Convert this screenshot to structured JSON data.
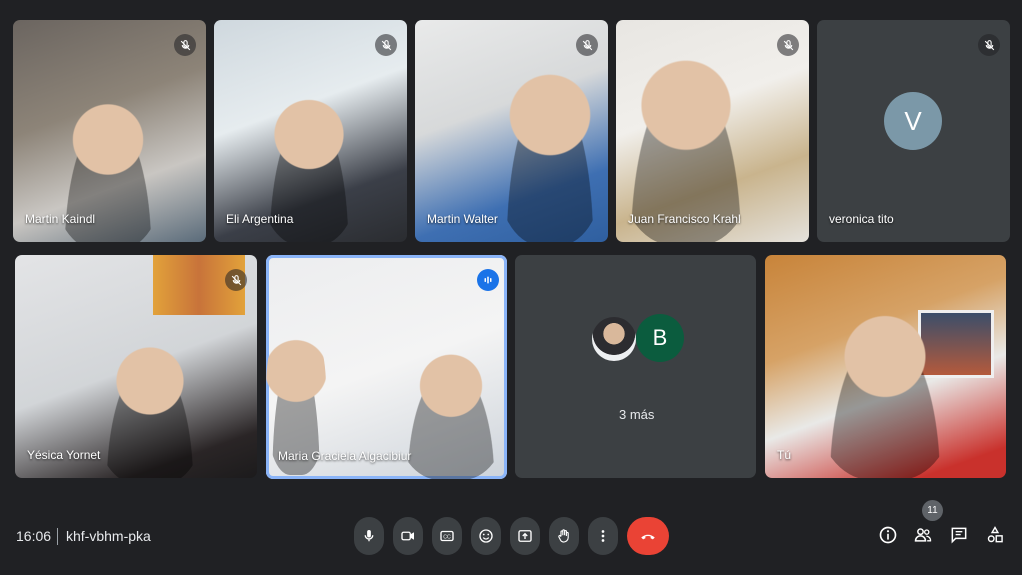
{
  "participants": [
    {
      "name": "Martin Kaindl",
      "muted": true
    },
    {
      "name": "Eli Argentina",
      "muted": true
    },
    {
      "name": "Martin Walter",
      "muted": true
    },
    {
      "name": "Juan Francisco Krahl",
      "muted": true
    },
    {
      "name": "veronica tito",
      "muted": true,
      "avatar_letter": "V",
      "avatar_color": "#7b98a8"
    },
    {
      "name": "Yésica Yornet",
      "muted": true
    },
    {
      "name": "Maria Graciela Algacibiur",
      "speaking": true
    },
    {
      "more_label": "3 más",
      "avatar_letter": "B",
      "avatar_color": "#0b5c3e"
    },
    {
      "name": "Tú"
    }
  ],
  "bottom_bar": {
    "time": "16:06",
    "meeting_code": "khf-vbhm-pka",
    "participants_count": "11",
    "hangup_color": "#ea4335",
    "controls": [
      "mic-icon",
      "camera-icon",
      "captions-icon",
      "emoji-icon",
      "present-icon",
      "raise-hand-icon",
      "more-options-icon",
      "hangup-icon"
    ],
    "right_icons": [
      "info-icon",
      "people-icon",
      "chat-icon",
      "activities-icon"
    ]
  }
}
